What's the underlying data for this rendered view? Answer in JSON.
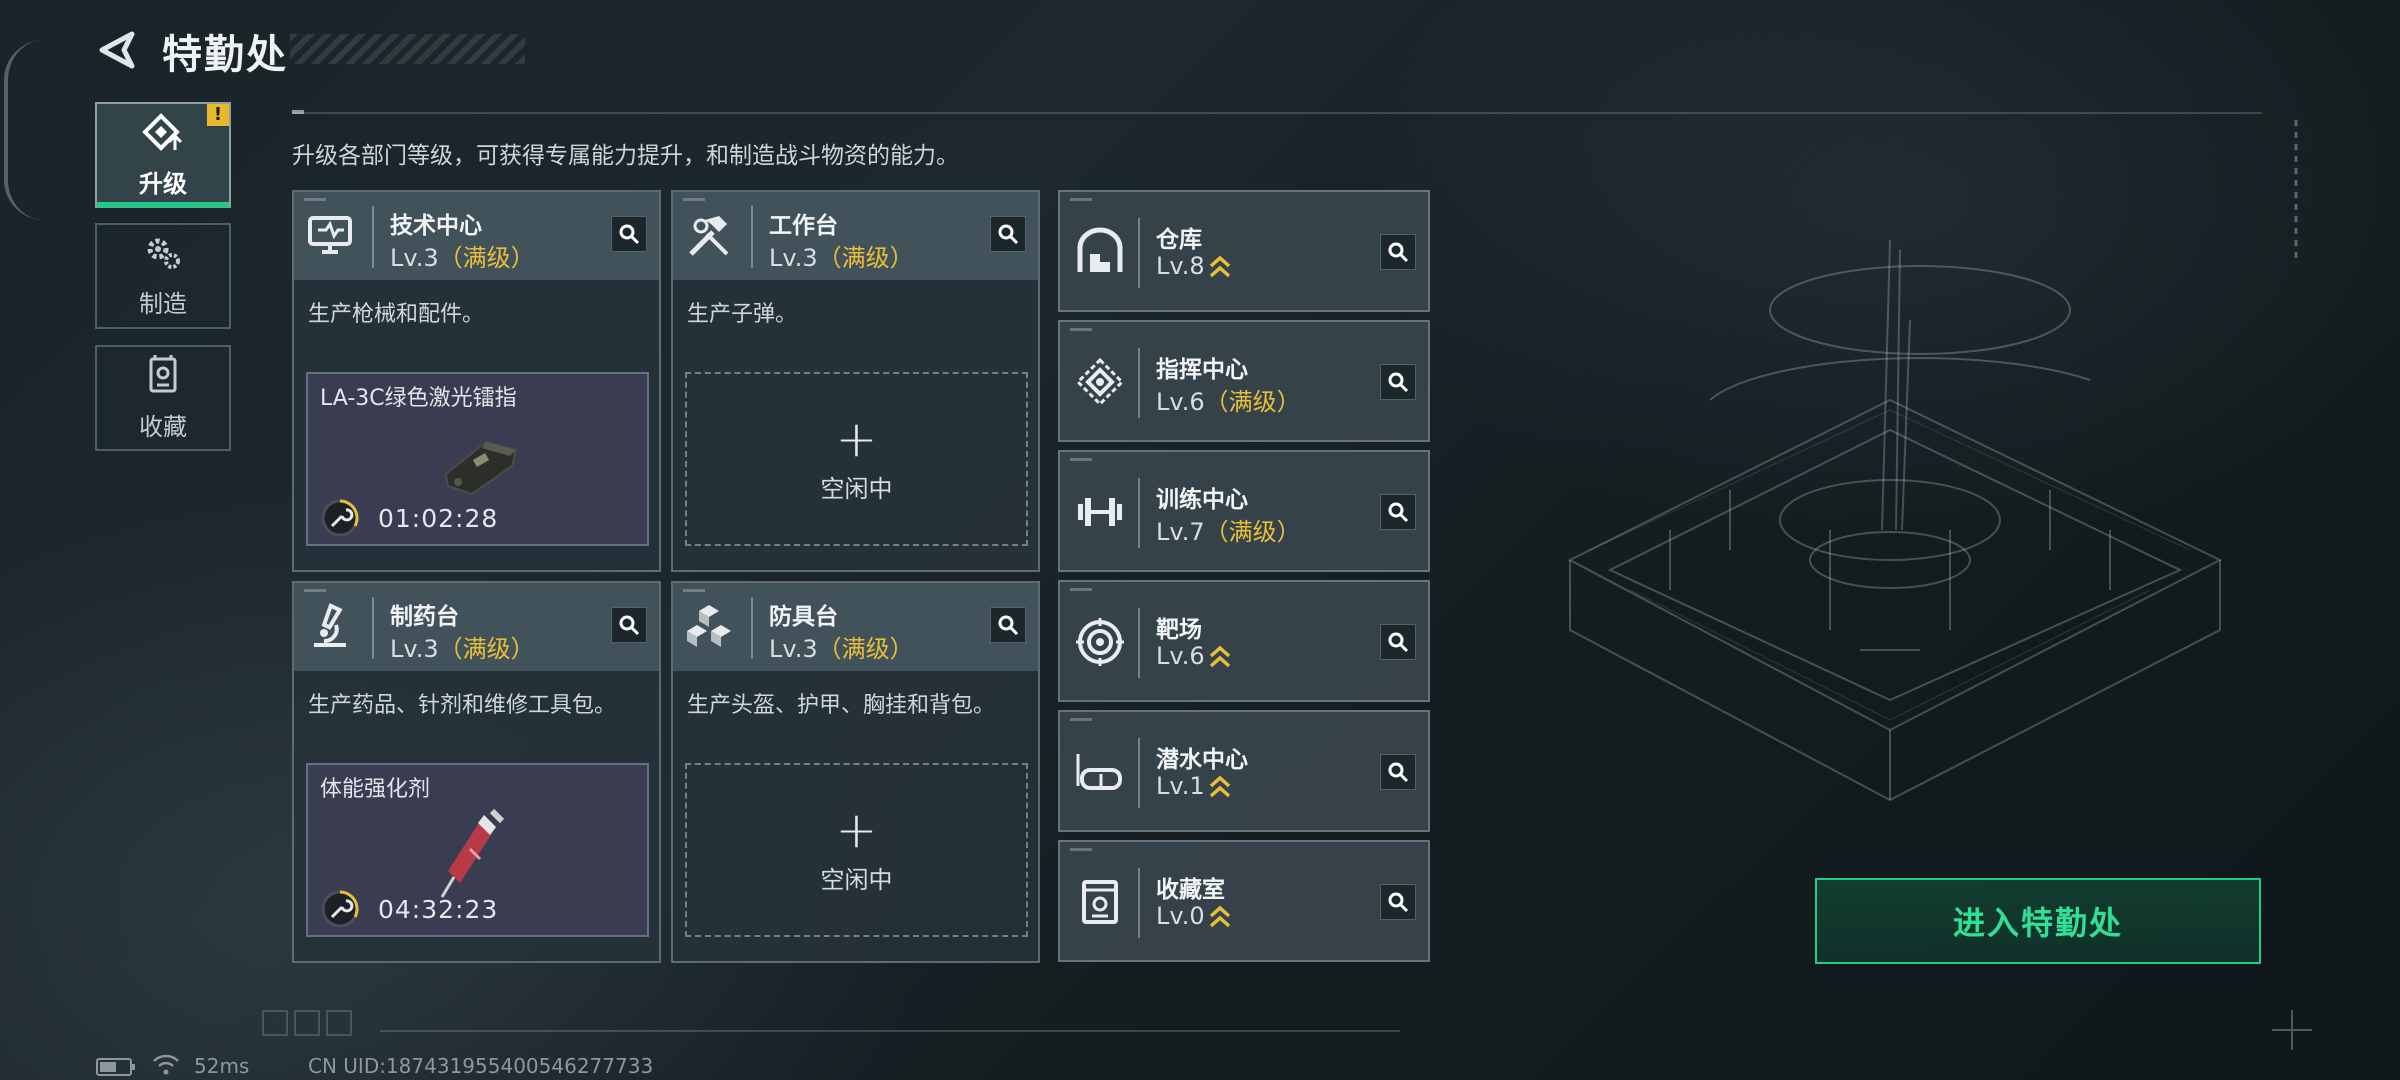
{
  "header": {
    "title": "特勤处"
  },
  "sidebar": {
    "tabs": [
      {
        "label": "升级",
        "icon": "upgrade-icon",
        "active": true,
        "alert": "!"
      },
      {
        "label": "制造",
        "icon": "craft-gear-icon",
        "active": false
      },
      {
        "label": "收藏",
        "icon": "collection-icon",
        "active": false
      }
    ]
  },
  "description": "升级各部门等级，可获得专属能力提升，和制造战斗物资的能力。",
  "departments": {
    "tech_center": {
      "name": "技术中心",
      "level": "Lv.3",
      "status": "（满级）",
      "desc": "生产枪械和配件。",
      "production": {
        "item": "LA-3C绿色激光镭指",
        "timer": "01:02:28"
      }
    },
    "workbench": {
      "name": "工作台",
      "level": "Lv.3",
      "status": "（满级）",
      "desc": "生产子弹。",
      "idle": {
        "plus": "+",
        "text": "空闲中"
      }
    },
    "pharmacy": {
      "name": "制药台",
      "level": "Lv.3",
      "status": "（满级）",
      "desc": "生产药品、针剂和维修工具包。",
      "production": {
        "item": "体能强化剂",
        "timer": "04:32:23"
      }
    },
    "armor_bench": {
      "name": "防具台",
      "level": "Lv.3",
      "status": "（满级）",
      "desc": "生产头盔、护甲、胸挂和背包。",
      "idle": {
        "plus": "+",
        "text": "空闲中"
      }
    },
    "warehouse": {
      "name": "仓库",
      "level": "Lv.8",
      "status": ""
    },
    "command_center": {
      "name": "指挥中心",
      "level": "Lv.6",
      "status": "（满级）"
    },
    "training_center": {
      "name": "训练中心",
      "level": "Lv.7",
      "status": "（满级）"
    },
    "shooting_range": {
      "name": "靶场",
      "level": "Lv.6",
      "status": ""
    },
    "diving_center": {
      "name": "潜水中心",
      "level": "Lv.1",
      "status": ""
    },
    "collection_room": {
      "name": "收藏室",
      "level": "Lv.0",
      "status": ""
    }
  },
  "enter_button": {
    "label": "进入特勤处"
  },
  "status_bar": {
    "ping": "52ms",
    "uid": "CN UID:1874319554005462777​33"
  },
  "colors": {
    "accent_green": "#1fce85",
    "max_level_gold": "#e9bf3a",
    "alert_yellow": "#e8b82c"
  }
}
